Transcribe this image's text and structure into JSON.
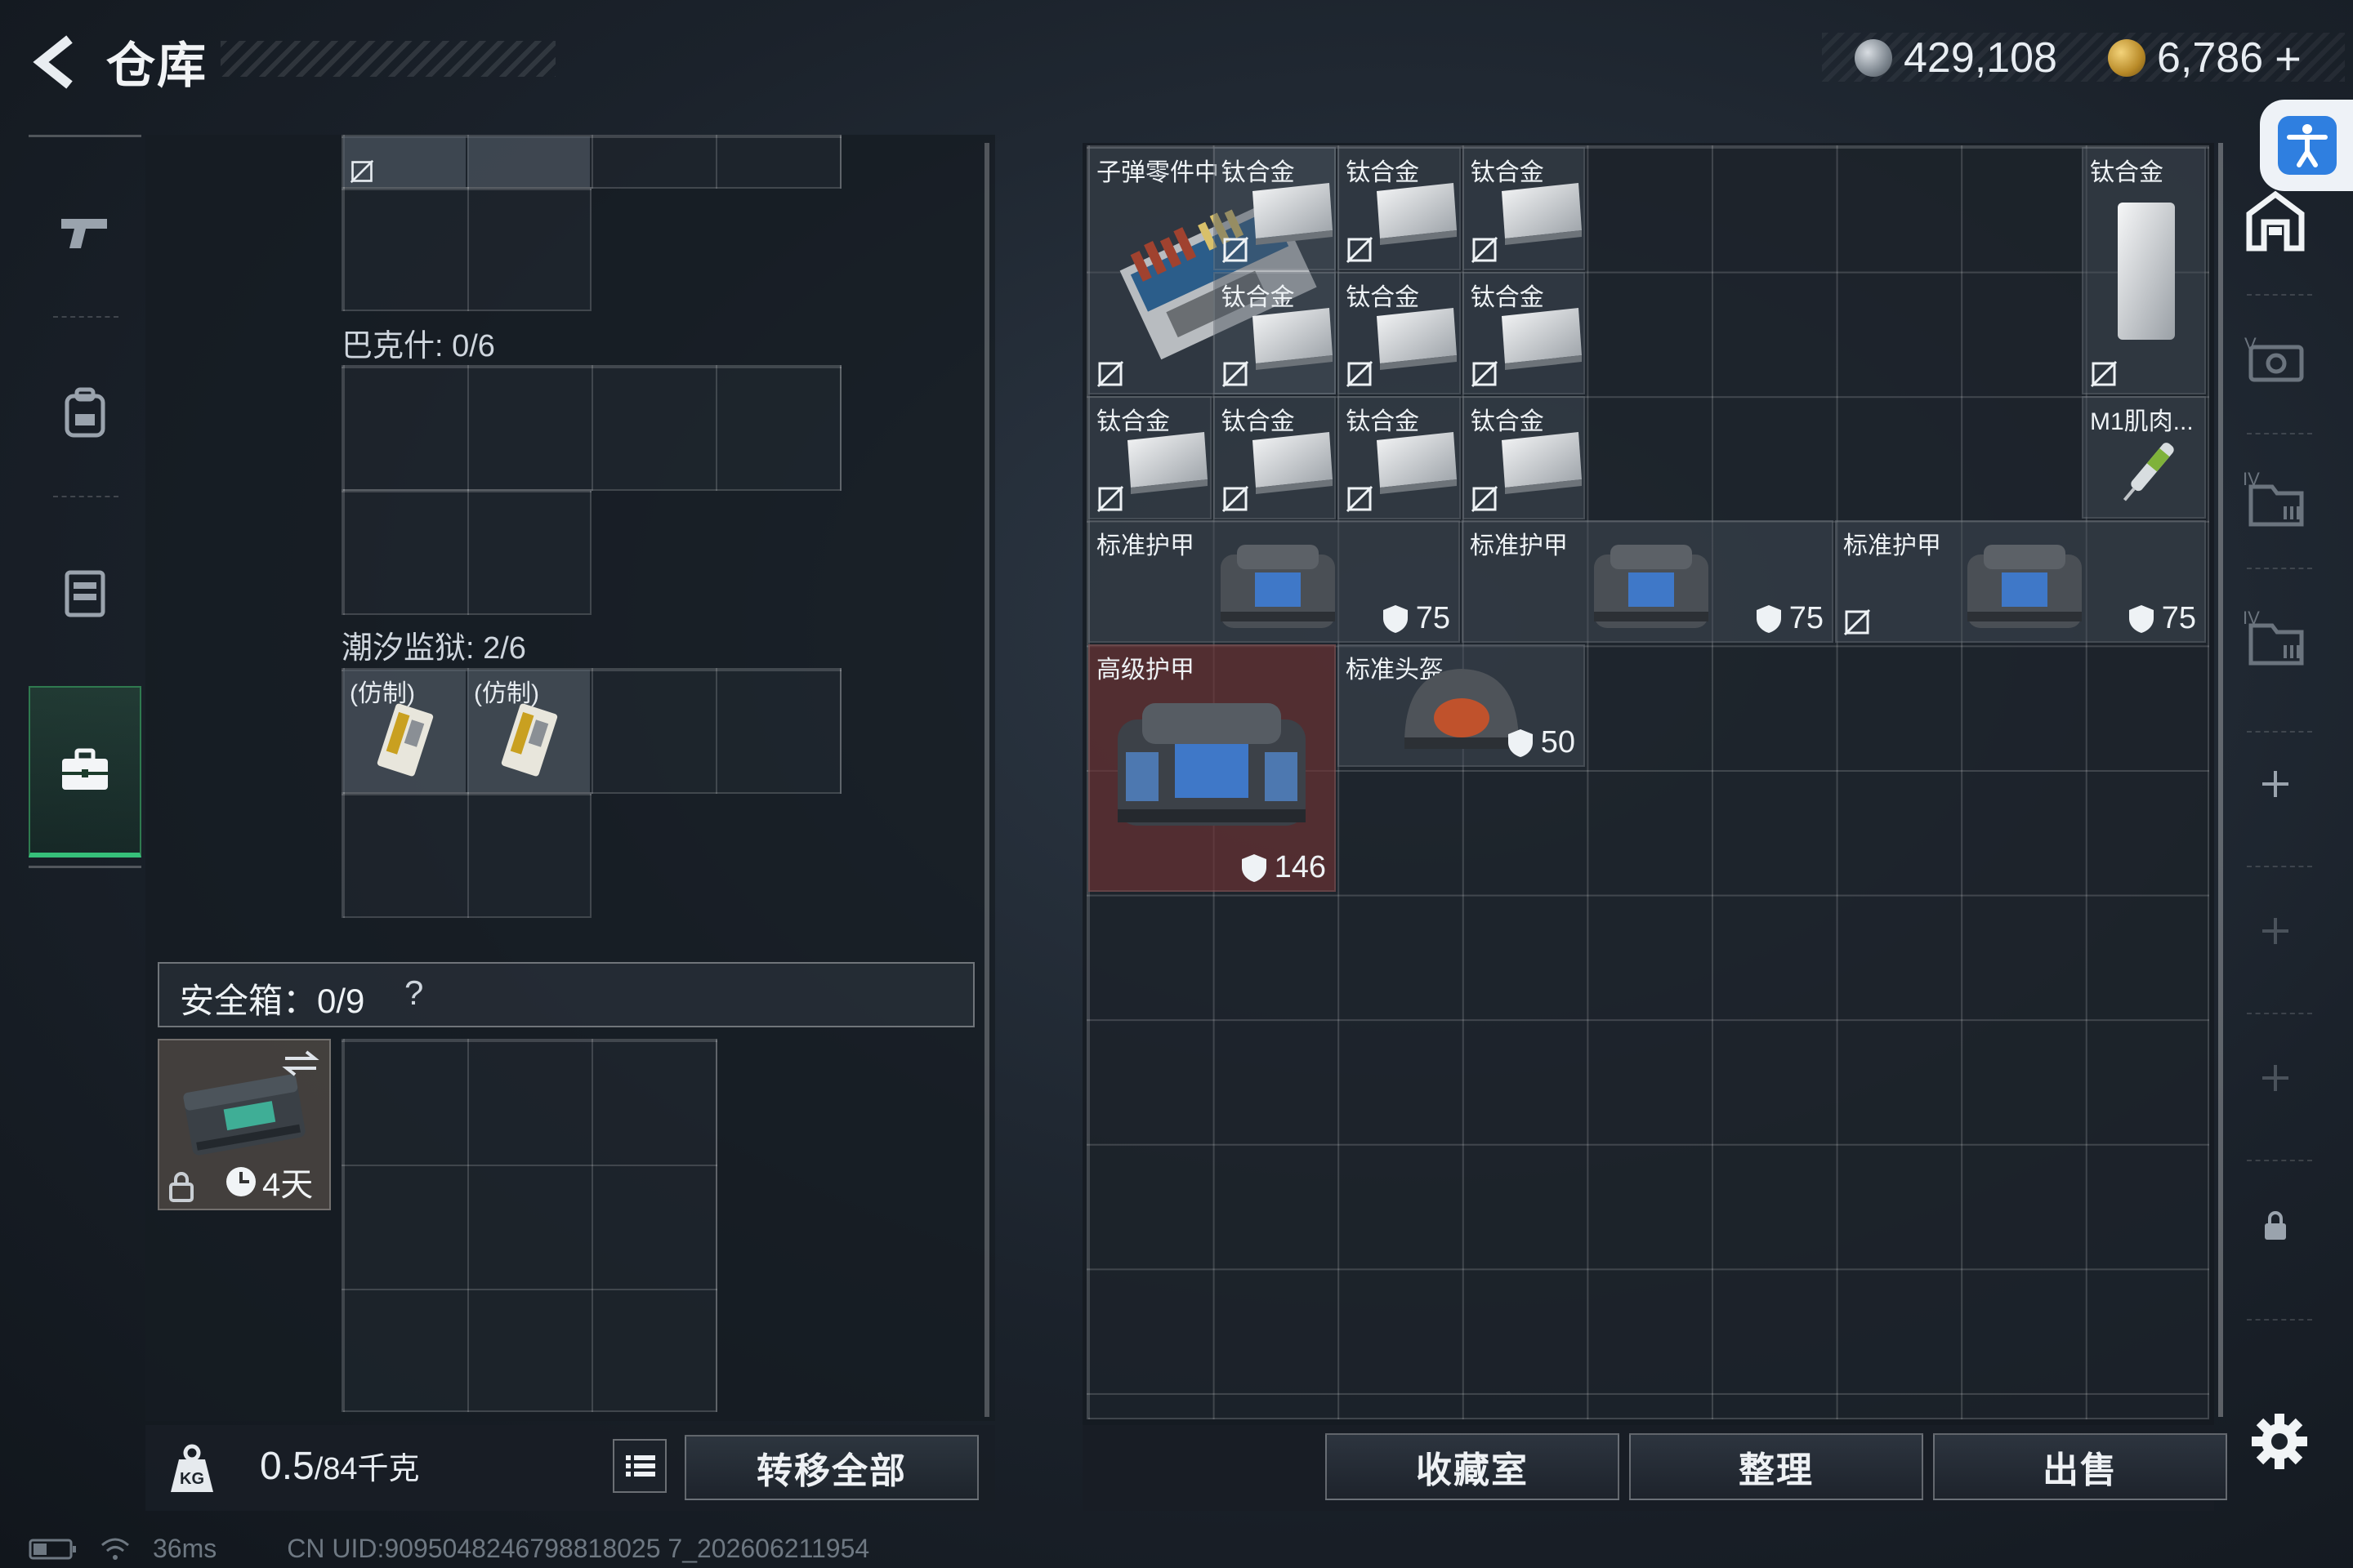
{
  "header": {
    "title": "仓库",
    "currency_1": "429,108",
    "currency_2": "6,786",
    "currency_2_add": "+"
  },
  "left_nav": {
    "items": [
      {
        "name": "weapon-tab",
        "icon": "pistol-icon"
      },
      {
        "name": "backpack-tab",
        "icon": "backpack-icon"
      },
      {
        "name": "chest-rig-tab",
        "icon": "vest-icon"
      },
      {
        "name": "secure-case-tab",
        "icon": "briefcase-icon",
        "active": true
      }
    ]
  },
  "left_panel": {
    "section_1_label": "巴克什: 0/6",
    "section_2_label": "潮汐监狱: 2/6",
    "section_2_items": [
      {
        "label": "(仿制)"
      },
      {
        "label": "(仿制)"
      }
    ],
    "safe_box_label": "安全箱：0/9",
    "safe_box_help": "?",
    "safe_case_timer": "4天"
  },
  "bottom_left": {
    "weight_value": "0.5",
    "weight_max": "/84千克",
    "transfer_all": "转移全部"
  },
  "status_bar": {
    "ping": "36ms",
    "uid": "CN UID:9095048246798818025 7_202606211954"
  },
  "stash": {
    "items": [
      {
        "label": "子弹零件中",
        "type": "ammo-parts-box"
      },
      {
        "label": "钛合金",
        "type": "titanium-plate"
      },
      {
        "label": "钛合金",
        "type": "titanium-plate"
      },
      {
        "label": "钛合金",
        "type": "titanium-plate"
      },
      {
        "label": "钛合金",
        "type": "titanium-plate"
      },
      {
        "label": "钛合金",
        "type": "titanium-plate"
      },
      {
        "label": "钛合金",
        "type": "titanium-plate"
      },
      {
        "label": "钛合金",
        "type": "titanium-plate"
      },
      {
        "label": "钛合金",
        "type": "titanium-plate"
      },
      {
        "label": "钛合金",
        "type": "titanium-plate"
      },
      {
        "label": "钛合金",
        "type": "titanium-plate"
      },
      {
        "label": "钛合金",
        "type": "titanium-plate"
      },
      {
        "label": "M1肌肉...",
        "type": "injector"
      },
      {
        "label": "标准护甲",
        "durability": "75",
        "type": "armor"
      },
      {
        "label": "标准护甲",
        "durability": "75",
        "type": "armor"
      },
      {
        "label": "标准护甲",
        "durability": "75",
        "type": "armor"
      },
      {
        "label": "高级护甲",
        "durability": "146",
        "type": "armor"
      },
      {
        "label": "标准头盔",
        "durability": "50",
        "type": "helmet"
      }
    ]
  },
  "actions": {
    "collection": "收藏室",
    "sort": "整理",
    "sell": "出售"
  },
  "colors": {
    "active_tab": "#36c07a",
    "accessibility": "#2f7fe0",
    "high_tier_bg": "#6e3234"
  }
}
